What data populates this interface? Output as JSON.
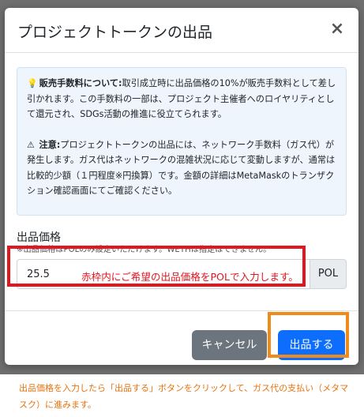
{
  "modal": {
    "title": "プロジェクトトークンの出品",
    "close_label": "×"
  },
  "info": {
    "fee_icon": "💡",
    "fee_heading": "販売手数料について:",
    "fee_text": "取引成立時に出品価格の10%が販売手数料として差し引かれます。この手数料の一部は、プロジェクト主催者へのロイヤリティとして還元され、SDGs活動の推進に役立てられます。",
    "warning_icon": "⚠",
    "warning_heading": "注意:",
    "warning_text": "プロジェクトトークンの出品には、ネットワーク手数料（ガス代）が発生します。ガス代はネットワークの混雑状況に応じて変動しますが、通常は比較的少額（１円程度※円換算）です。金額の詳細はMetaMaskのトランザクション確認画面にてご確認ください。"
  },
  "price": {
    "label": "出品価格",
    "note": "※出品価格はPOLのみ設定いただけます。WETHは指定はできません。",
    "value": "25.5",
    "currency": "POL"
  },
  "annotation": {
    "input_hint": "赤枠内にご希望の出品価格をPOLで入力します。",
    "caption": "出品価格を入力したら「出品する」ボタンをクリックして、ガス代の支払い（メタマスク）に進みます。"
  },
  "footer": {
    "cancel_label": "キャンセル",
    "submit_label": "出品する"
  },
  "colors": {
    "primary": "#0d6efd",
    "secondary": "#6c757d",
    "highlight_red": "#e3151f",
    "highlight_orange": "#f08a1b"
  }
}
